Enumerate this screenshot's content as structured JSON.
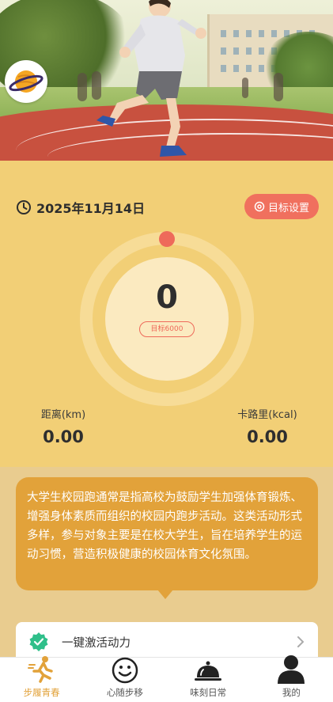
{
  "header": {
    "badge_icon": "planet-icon"
  },
  "stats": {
    "date": "2025年11月14日",
    "goal_button_label": "目标设置",
    "steps": "0",
    "goal_tag": "目标6000",
    "distance_label": "距离(km)",
    "distance_value": "0.00",
    "calories_label": "卡路里(kcal)",
    "calories_value": "0.00"
  },
  "info": {
    "description": "大学生校园跑通常是指高校为鼓励学生加强体育锻炼、增强身体素质而组织的校园内跑步活动。这类活动形式多样，参与对象主要是在校大学生，旨在培养学生的运动习惯，营造积极健康的校园体育文化氛围。",
    "action_label": "一键激活动力"
  },
  "tabs": [
    {
      "label": "步履青春",
      "icon": "runner-icon",
      "active": true
    },
    {
      "label": "心随步移",
      "icon": "smiley-icon",
      "active": false
    },
    {
      "label": "味刻日常",
      "icon": "food-cloche-icon",
      "active": false
    },
    {
      "label": "我的",
      "icon": "user-icon",
      "active": false
    }
  ],
  "colors": {
    "panel_bg": "#f2cf76",
    "accent_red": "#ee6a5a",
    "bubble": "#e2a23a",
    "active_tab": "#e2a23a"
  }
}
